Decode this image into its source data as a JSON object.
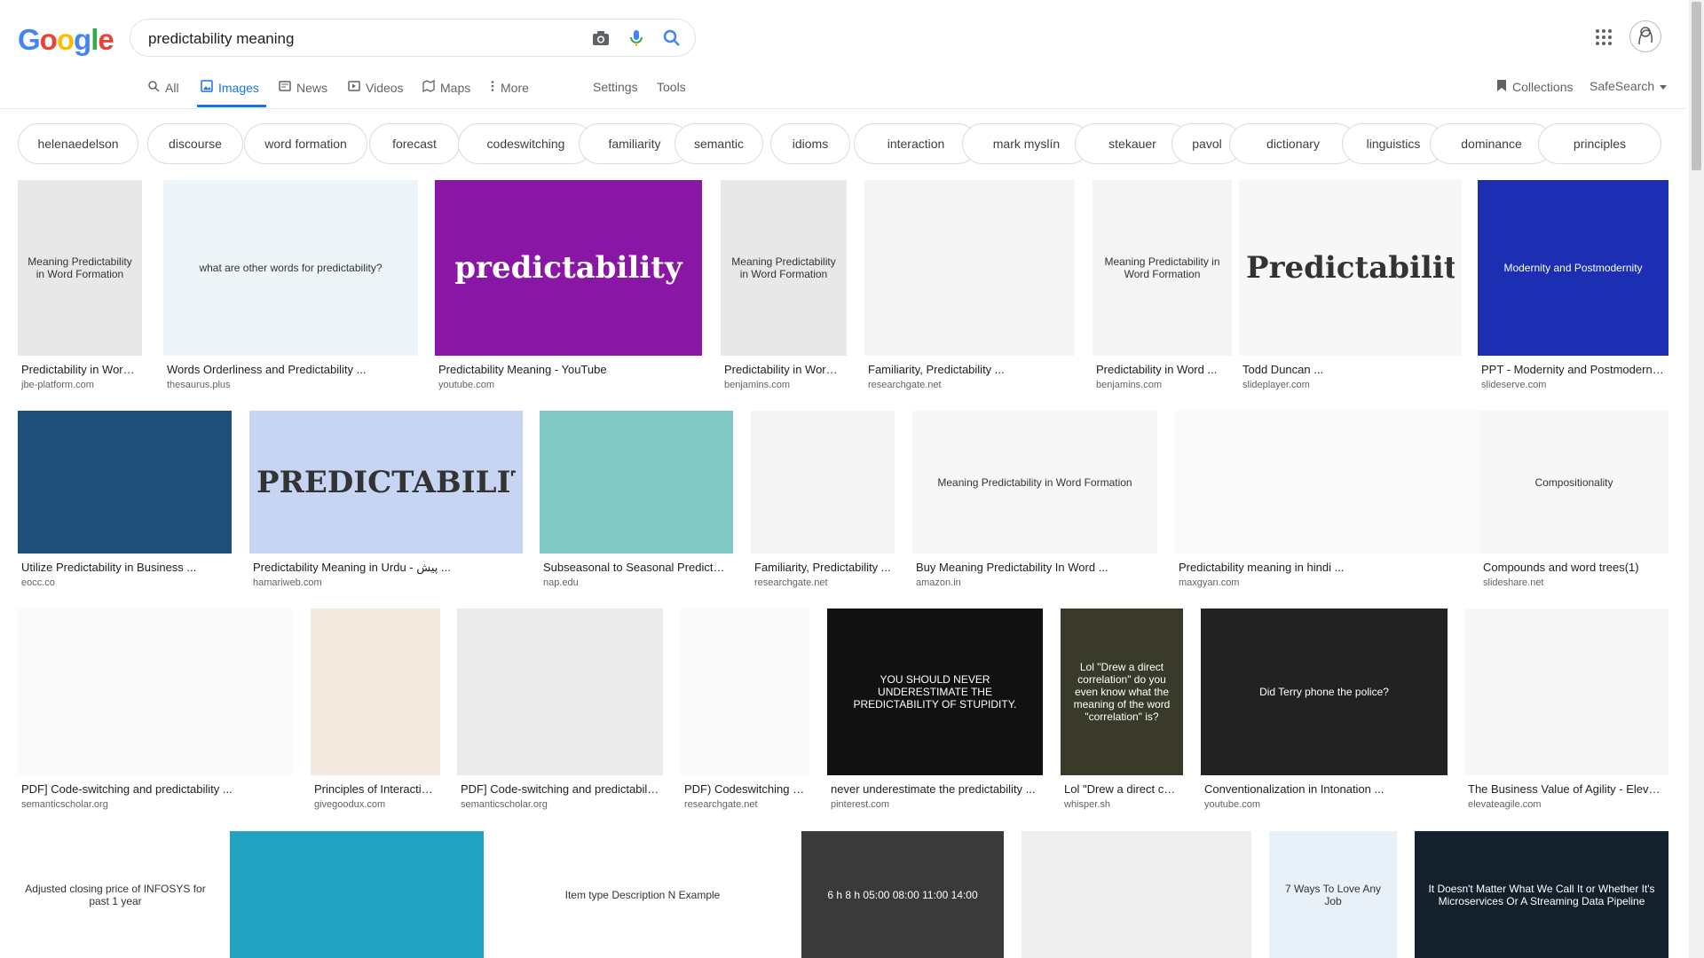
{
  "search": {
    "query": "predictability meaning"
  },
  "logo": {
    "text": "Google"
  },
  "tabs": [
    {
      "label": "All"
    },
    {
      "label": "Images"
    },
    {
      "label": "News"
    },
    {
      "label": "Videos"
    },
    {
      "label": "Maps"
    },
    {
      "label": "More"
    },
    {
      "label": "Settings"
    },
    {
      "label": "Tools"
    }
  ],
  "header_right": {
    "collections": "Collections",
    "safesearch": "SafeSearch"
  },
  "chips": [
    "helenaedelson",
    "discourse",
    "word formation",
    "forecast",
    "codeswitching",
    "familiarity",
    "semantic",
    "idioms",
    "interaction",
    "mark myslín",
    "stekauer",
    "pavol",
    "dictionary",
    "linguistics",
    "dominance",
    "principles"
  ],
  "results": [
    {
      "title": "Predictability in Word ...",
      "source": "jbe-platform.com",
      "img_text": "Meaning Predictability in Word Formation",
      "bg": "#e8e8e8"
    },
    {
      "title": "Words Orderliness and Predictability ...",
      "source": "thesaurus.plus",
      "img_text": "what are other words for predictability?",
      "bg": "#eef5f8"
    },
    {
      "title": "Predictability Meaning - YouTube",
      "source": "youtube.com",
      "img_text": "predictability",
      "bg": "#8a16a5"
    },
    {
      "title": "Predictability in Word ...",
      "source": "benjamins.com",
      "img_text": "Meaning Predictability in Word Formation",
      "bg": "#e8e8e8"
    },
    {
      "title": "Familiarity, Predictability ...",
      "source": "researchgate.net",
      "img_text": "",
      "bg": "#f4f4f4"
    },
    {
      "title": "Predictability in Word ...",
      "source": "benjamins.com",
      "img_text": "Meaning Predictability in Word Formation",
      "bg": "#f4f4f4"
    },
    {
      "title": "Todd Duncan ...",
      "source": "slideplayer.com",
      "img_text": "Predictability",
      "bg": "#f7f7f7"
    },
    {
      "title": "PPT - Modernity and Postmodernit...",
      "source": "slideserve.com",
      "img_text": "Modernity and Postmodernity",
      "bg": "#1c2fb3"
    },
    {
      "title": "Utilize Predictability in Business ...",
      "source": "eocc.co",
      "img_text": "",
      "bg": "#1d4f7a"
    },
    {
      "title": "Predictability Meaning in Urdu - پیش ...",
      "source": "hamariweb.com",
      "img_text": "PREDICTABILITY",
      "bg": "#c7d5f3"
    },
    {
      "title": "Subseasonal to Seasonal Predictab...",
      "source": "nap.edu",
      "img_text": "",
      "bg": "#7fc8c4"
    },
    {
      "title": "Familiarity, Predictability ...",
      "source": "researchgate.net",
      "img_text": "",
      "bg": "#f4f4f4"
    },
    {
      "title": "Buy Meaning Predictability In Word ...",
      "source": "amazon.in",
      "img_text": "Meaning Predictability in Word Formation",
      "bg": "#f7f7f7"
    },
    {
      "title": "Predictability meaning in hindi ...",
      "source": "maxgyan.com",
      "img_text": "",
      "bg": "#fafafa"
    },
    {
      "title": "Compounds and word trees(1)",
      "source": "slideshare.net",
      "img_text": "Compositionality",
      "bg": "#f7f7f7"
    },
    {
      "title": "PDF] Code-switching and predictability ...",
      "source": "semanticscholar.org",
      "img_text": "",
      "bg": "#fafafa"
    },
    {
      "title": "Principles of Interactio...",
      "source": "givegoodux.com",
      "img_text": "",
      "bg": "#f3e9de"
    },
    {
      "title": "PDF] Code-switching and predictabilit...",
      "source": "semanticscholar.org",
      "img_text": "",
      "bg": "#ebebeb"
    },
    {
      "title": "PDF) Codeswitching a...",
      "source": "researchgate.net",
      "img_text": "",
      "bg": "#fafafa"
    },
    {
      "title": "never underestimate the predictability ...",
      "source": "pinterest.com",
      "img_text": "YOU SHOULD NEVER UNDERESTIMATE THE PREDICTABILITY OF STUPIDITY.",
      "bg": "#111111"
    },
    {
      "title": "Lol \"Drew a direct corr...",
      "source": "whisper.sh",
      "img_text": "Lol \"Drew a direct correlation\" do you even know what the meaning of the word \"correlation\" is?",
      "bg": "#3a3a2a"
    },
    {
      "title": "Conventionalization in Intonation ...",
      "source": "youtube.com",
      "img_text": "Did Terry phone the police?",
      "bg": "#222222"
    },
    {
      "title": "The Business Value of Agility - Elevat...",
      "source": "elevateagile.com",
      "img_text": "",
      "bg": "#f7f7f7"
    },
    {
      "title": "",
      "source": "",
      "img_text": "Adjusted closing price of INFOSYS for past 1 year",
      "bg": "#ffffff"
    },
    {
      "title": "",
      "source": "",
      "img_text": "",
      "bg": "#22a3c4"
    },
    {
      "title": "",
      "source": "",
      "img_text": "Item type  Description  N  Example",
      "bg": "#ffffff"
    },
    {
      "title": "",
      "source": "",
      "img_text": "6 h  8 h  05:00  08:00  11:00  14:00",
      "bg": "#3a3a3a"
    },
    {
      "title": "",
      "source": "",
      "img_text": "",
      "bg": "#eeeeee"
    },
    {
      "title": "",
      "source": "",
      "img_text": "7 Ways To Love Any Job",
      "bg": "#e8f0f8"
    },
    {
      "title": "",
      "source": "",
      "img_text": "It Doesn't Matter What We Call It or Whether It's Microservices Or A Streaming Data Pipeline",
      "bg": "#14202c"
    }
  ],
  "colors": {
    "accent": "#1a73e8",
    "g_blue": "#4285f4",
    "g_red": "#ea4335",
    "g_yellow": "#fbbc05",
    "g_green": "#34a853"
  }
}
